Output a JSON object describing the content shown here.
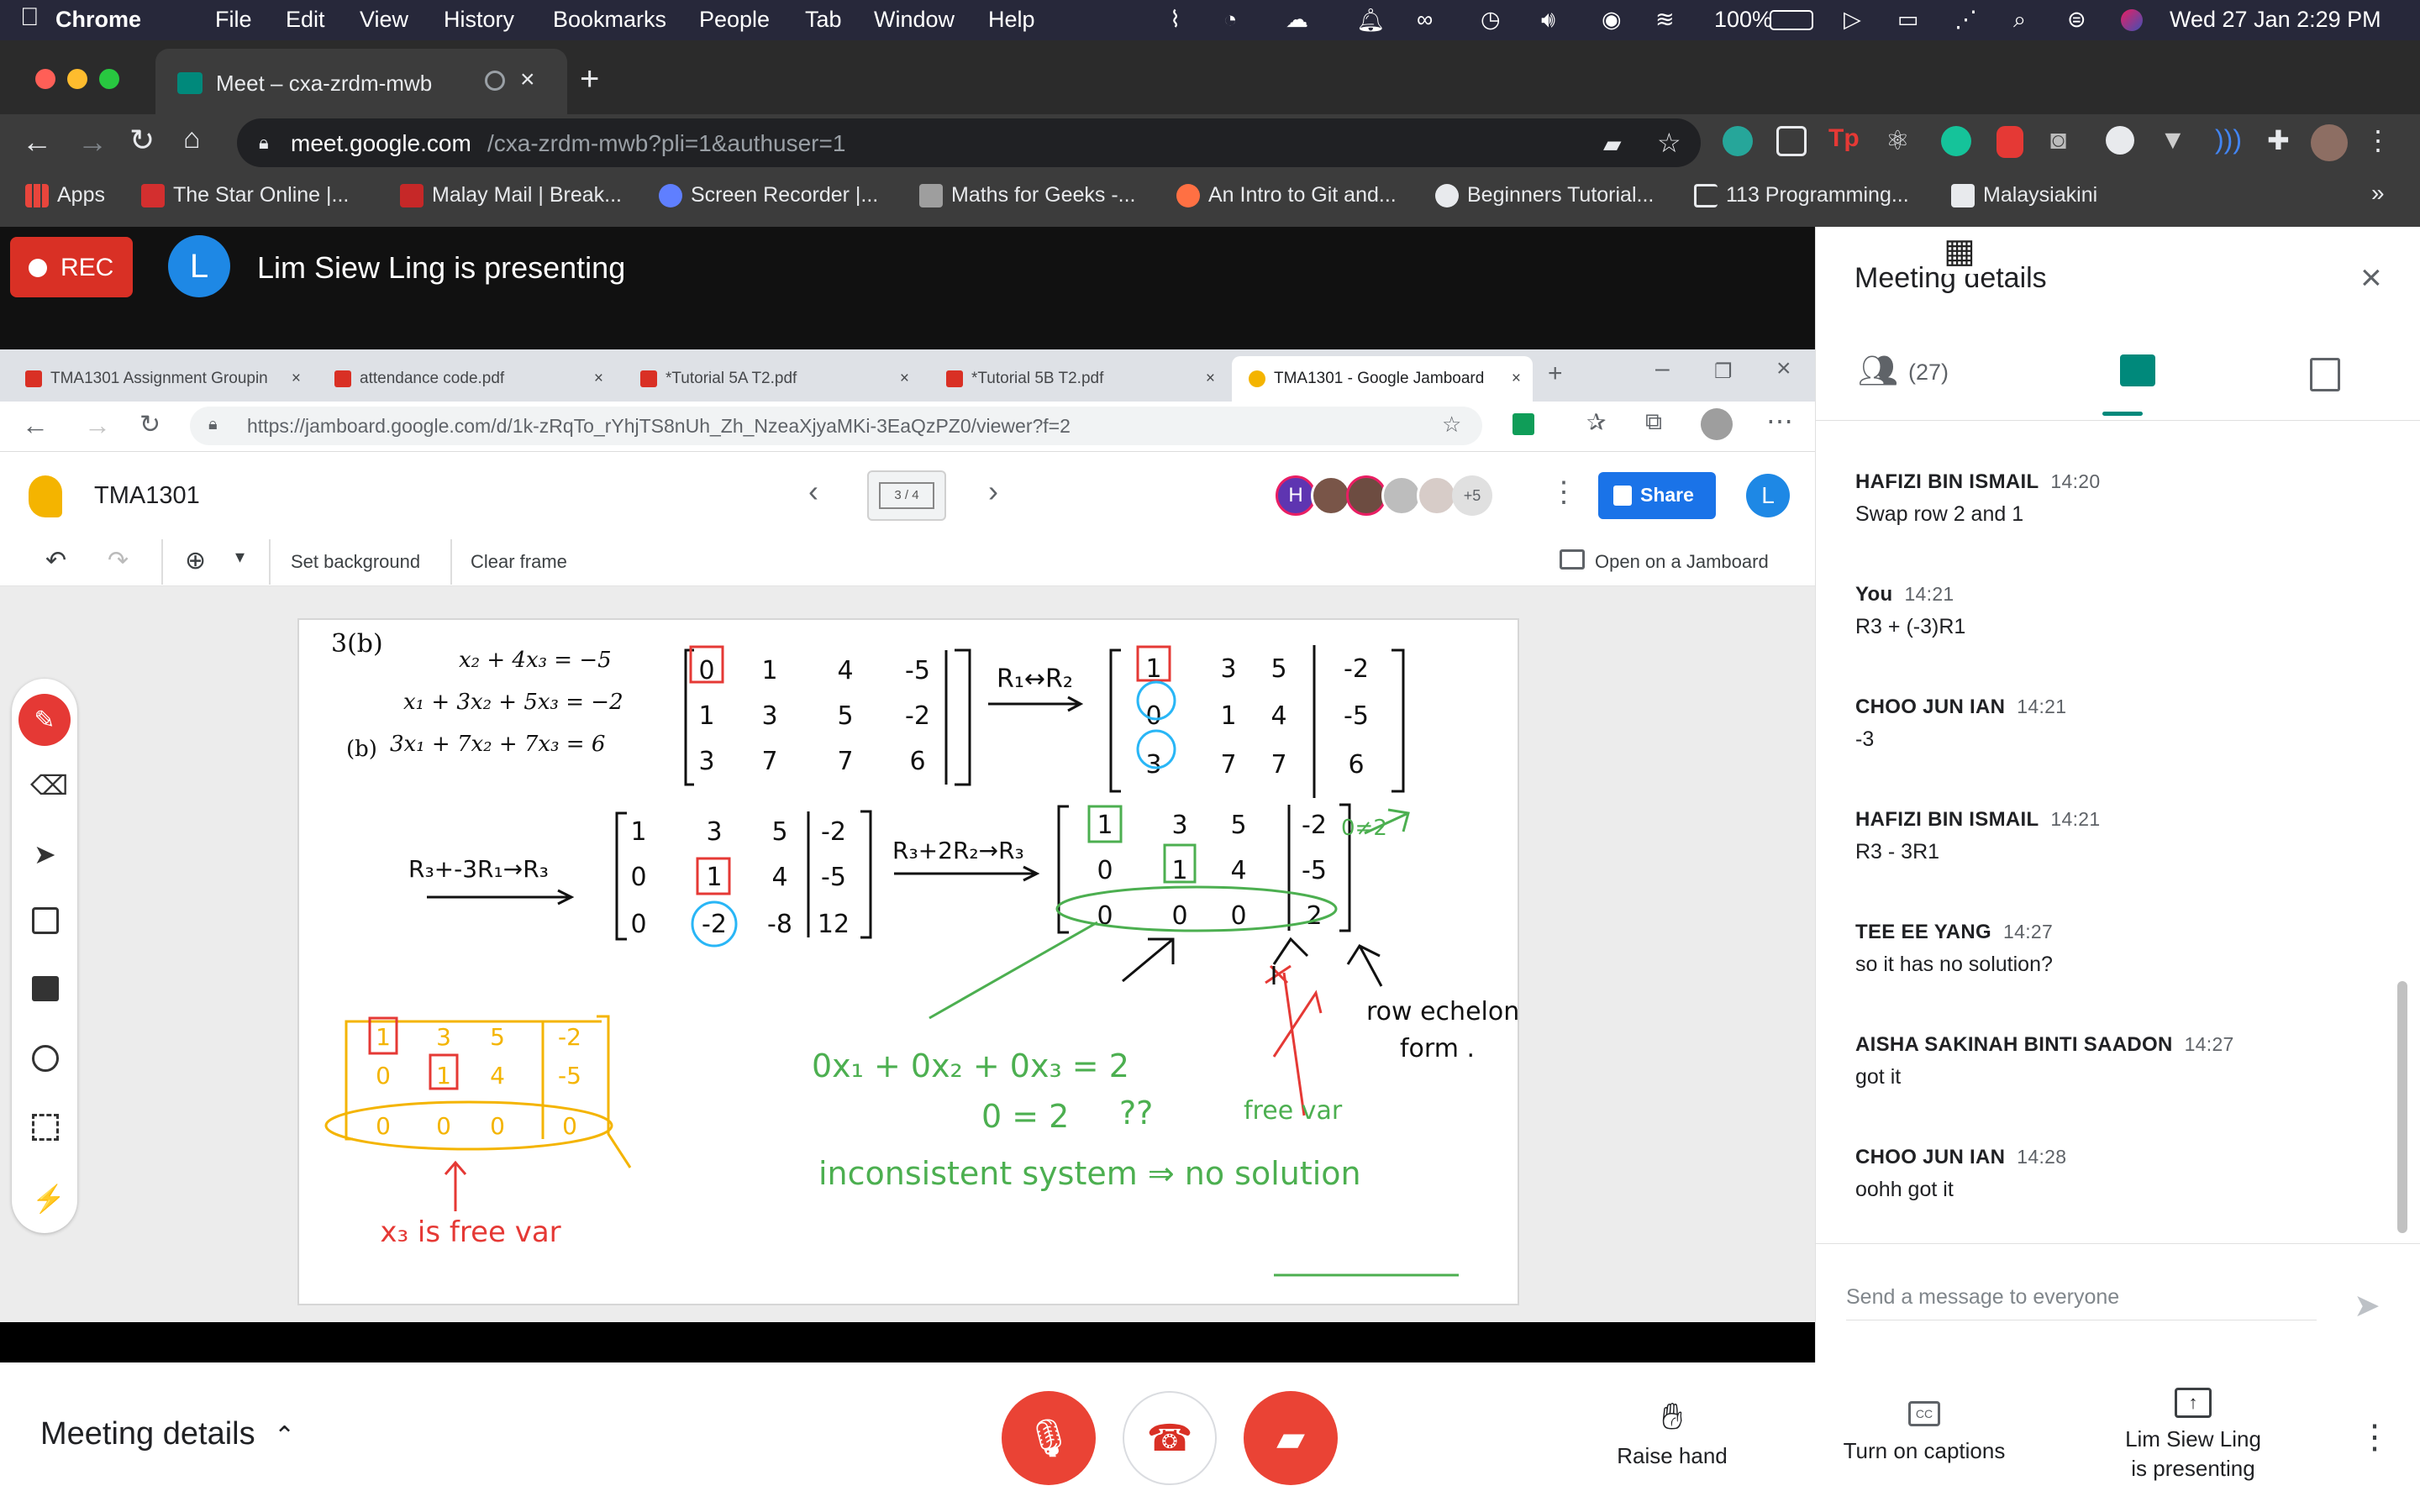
{
  "menubar": {
    "app": "Chrome",
    "items": [
      "File",
      "Edit",
      "View",
      "History",
      "Bookmarks",
      "People",
      "Tab",
      "Window",
      "Help"
    ],
    "battery": "100%",
    "clock": "Wed 27 Jan  2:29 PM"
  },
  "browser": {
    "tab_title": "Meet – cxa-zrdm-mwb",
    "url_host": "meet.google.com",
    "url_path": "/cxa-zrdm-mwb?pli=1&authuser=1",
    "bookmarks": [
      {
        "label": "Apps",
        "color": "#e8eaed"
      },
      {
        "label": "The Star Online |...",
        "color": "#d32f2f"
      },
      {
        "label": "Malay Mail | Break...",
        "color": "#c62828"
      },
      {
        "label": "Screen Recorder |...",
        "color": "#5f7fff"
      },
      {
        "label": "Maths for Geeks -...",
        "color": "#9e9e9e"
      },
      {
        "label": "An Intro to Git and...",
        "color": "#ff7043"
      },
      {
        "label": "Beginners Tutorial...",
        "color": "#e8eaed"
      },
      {
        "label": "113 Programming...",
        "color": "#e8eaed"
      },
      {
        "label": "Malaysiakini",
        "color": "#e8eaed"
      }
    ]
  },
  "meet": {
    "rec_label": "REC",
    "presenter_initial": "L",
    "presenting_text": "Lim Siew Ling is presenting",
    "shared": {
      "tabs": [
        "TMA1301 Assignment Groupin",
        "attendance code.pdf",
        "*Tutorial 5A T2.pdf",
        "*Tutorial 5B T2.pdf",
        "TMA1301 - Google Jamboard"
      ],
      "url": "https://jamboard.google.com/d/1k-zRqTo_rYhjTS8nUh_Zh_NzeaXjyaMKi-3EaQzPZ0/viewer?f=2",
      "jam_title": "TMA1301",
      "frame_counter": "3 / 4",
      "more_collaborators": "+5",
      "share_label": "Share",
      "user_initial": "L",
      "collab_initial": "H",
      "tools": {
        "set_background": "Set background",
        "clear_frame": "Clear frame",
        "open_on_jamboard": "Open on a Jamboard"
      }
    }
  },
  "board": {
    "label_3b": "3(b)",
    "eq1": "x₂ + 4x₃ = −5",
    "eq2": "x₁ + 3x₂ + 5x₃ = −2",
    "eq_b": "(b)",
    "eq3": "3x₁ + 7x₂ + 7x₃ = 6",
    "m1": [
      "0",
      "1",
      "4",
      "-5",
      "1",
      "3",
      "5",
      "-2",
      "3",
      "7",
      "7",
      "6"
    ],
    "op1": "R₁↔R₂",
    "m2": [
      "1",
      "3",
      "5",
      "-2",
      "0",
      "1",
      "4",
      "-5",
      "3",
      "7",
      "7",
      "6"
    ],
    "op2": "R₃+-3R₁→R₃",
    "m3": [
      "1",
      "3",
      "5",
      "-2",
      "0",
      "1",
      "4",
      "-5",
      "0",
      "-2",
      "-8",
      "12"
    ],
    "op3": "R₃+2R₂→R₃",
    "m4": [
      "1",
      "3",
      "5",
      "-2",
      "0",
      "1",
      "4",
      "-5",
      "0",
      "0",
      "0",
      "2"
    ],
    "side_note": "0≠2",
    "row_echelon": "row echelon",
    "row_echelon2": "form .",
    "yellow_m": [
      "1",
      "3",
      "5",
      "-2",
      "0",
      "1",
      "4",
      "-5",
      "0",
      "0",
      "0",
      "0"
    ],
    "free_var_red": "x₃ is free var",
    "green_eq1": "0x₁ + 0x₂ + 0x₃ = 2",
    "green_eq2": "0 = 2",
    "green_q": "??",
    "green_free": "free var",
    "green_conclusion": "inconsistent system ⇒ no solution"
  },
  "panel": {
    "title": "Meeting details",
    "people_count": "(27)",
    "messages": [
      {
        "who": "HAFIZI BIN ISMAIL",
        "time": "14:20",
        "text": "Swap row 2 and 1"
      },
      {
        "who": "You",
        "time": "14:21",
        "text": "R3 + (-3)R1"
      },
      {
        "who": "CHOO JUN IAN",
        "time": "14:21",
        "text": "-3"
      },
      {
        "who": "HAFIZI BIN ISMAIL",
        "time": "14:21",
        "text": "R3 - 3R1"
      },
      {
        "who": "TEE EE YANG",
        "time": "14:27",
        "text": "so it has no solution?"
      },
      {
        "who": "AISHA SAKINAH BINTI SAADON",
        "time": "14:27",
        "text": "got it"
      },
      {
        "who": "CHOO JUN IAN",
        "time": "14:28",
        "text": "oohh got it"
      }
    ],
    "input_placeholder": "Send a message to everyone"
  },
  "bottom": {
    "meeting_details": "Meeting details",
    "raise_hand": "Raise hand",
    "captions": "Turn on captions",
    "presenting_line1": "Lim Siew Ling",
    "presenting_line2": "is presenting"
  },
  "colors": {
    "rec": "#d93025",
    "meet_green": "#00897b",
    "share_blue": "#1a73e8",
    "ink_black": "#111",
    "ink_green": "#4caf50",
    "ink_red": "#e53935",
    "ink_orange": "#f4b400",
    "ink_cyan": "#29b6f6"
  }
}
